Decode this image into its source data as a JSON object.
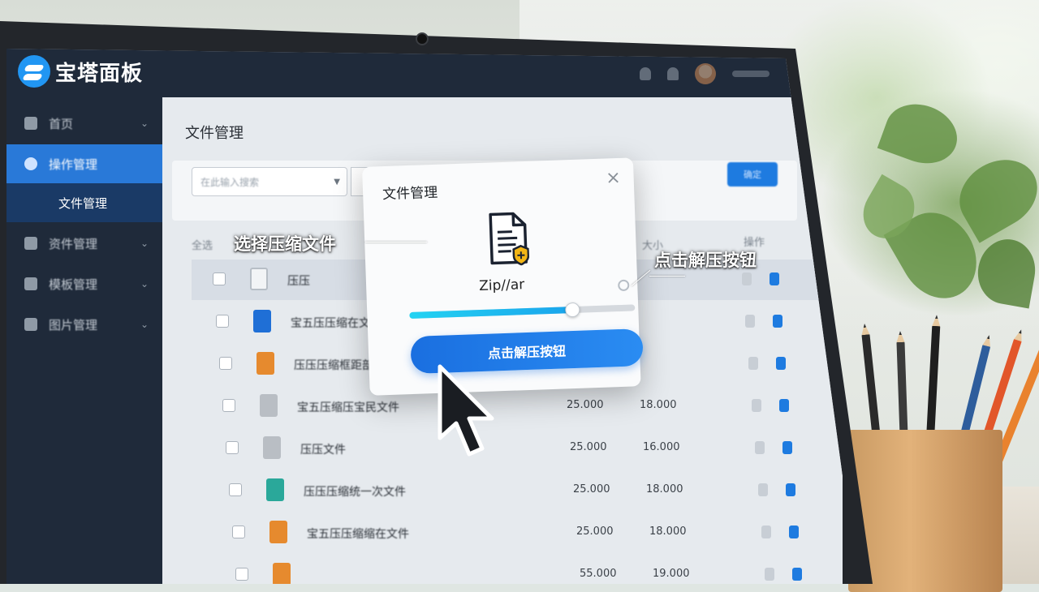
{
  "app": {
    "logo_text": "宝塔面板"
  },
  "sidebar": {
    "items": [
      {
        "label": "首页",
        "active": false
      },
      {
        "label": "操作管理",
        "active": true
      },
      {
        "label": "文件管理",
        "sub": true
      },
      {
        "label": "资件管理",
        "active": false
      },
      {
        "label": "模板管理",
        "active": false
      },
      {
        "label": "图片管理",
        "active": false
      }
    ]
  },
  "content": {
    "title": "文件管理",
    "search_placeholder": "在此输入搜索",
    "blue_button": "确定",
    "table_header": {
      "name": "全选",
      "col2": "大小",
      "col3": "操作"
    },
    "rows": [
      {
        "name": "压压",
        "size": "",
        "date": "",
        "icon": "outline"
      },
      {
        "name": "宝五压压缩在文件",
        "size": "",
        "date": "",
        "icon": "blue"
      },
      {
        "name": "压压压缩框距部",
        "size": "",
        "date": "",
        "icon": "orange"
      },
      {
        "name": "宝五压缩压宝民文件",
        "size": "25.000",
        "date": "18.000",
        "icon": "gray"
      },
      {
        "name": "压压文件",
        "size": "25.000",
        "date": "16.000",
        "icon": "gray"
      },
      {
        "name": "压压压缩统一次文件",
        "size": "25.000",
        "date": "18.000",
        "icon": "teal"
      },
      {
        "name": "宝五压压缩缩在文件",
        "size": "25.000",
        "date": "18.000",
        "icon": "orange"
      },
      {
        "name": "",
        "size": "55.000",
        "date": "19.000",
        "icon": "orange"
      }
    ]
  },
  "modal": {
    "title": "文件管理",
    "close": "×",
    "file_label": "Zip//ar",
    "progress": 0.72,
    "button_label": "点击解压按钮"
  },
  "annotations": {
    "select": "选择压缩文件",
    "click": "点击解压按钮"
  },
  "colors": {
    "accent": "#1e7be0",
    "progress": "#24d3f2",
    "sidebar_bg": "#1f2a3a"
  }
}
